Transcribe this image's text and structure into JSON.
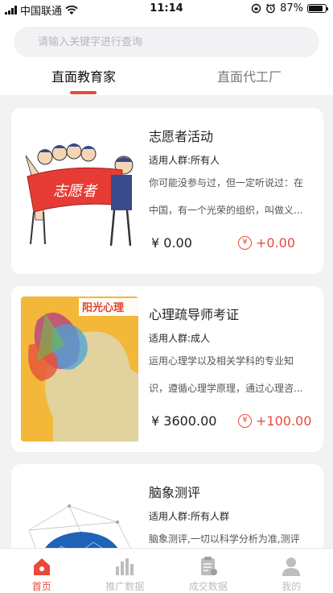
{
  "status": {
    "carrier": "中国联通",
    "time": "11:14",
    "battery": "87%",
    "battery_level": 0.87
  },
  "search": {
    "placeholder": "请输入关键字进行查询"
  },
  "tabs": [
    {
      "label": "直面教育家"
    },
    {
      "label": "直面代工厂"
    }
  ],
  "cards": [
    {
      "title": "志愿者活动",
      "audience": "适用人群:所有人",
      "desc1": "你可能没参与过，但一定听说过：在",
      "desc2": "中国，有一个光荣的组织，叫做义...",
      "price": "¥ 0.00",
      "reward": "+0.00",
      "image": "volunteer-illustration",
      "banner_text": "志愿者"
    },
    {
      "title": "心理疏导师考证",
      "audience": "适用人群:成人",
      "desc1": "运用心理学以及相关学科的专业知",
      "desc2": "识，遵循心理学原理，通过心理咨...",
      "price": "¥ 3600.00",
      "reward": "+100.00",
      "image": "psychology-poster",
      "banner_text": "阳光心理"
    },
    {
      "title": "脑象测评",
      "audience": "适用人群:所有人群",
      "desc1": "脑象测评,一切以科学分析为准,测评",
      "desc2": "",
      "price": "",
      "reward": "",
      "image": "brain-network"
    }
  ],
  "tabbar": [
    {
      "label": "首页",
      "icon": "home-icon"
    },
    {
      "label": "推广数据",
      "icon": "bar-chart-icon"
    },
    {
      "label": "成交数据",
      "icon": "clipboard-icon"
    },
    {
      "label": "我的",
      "icon": "user-icon"
    }
  ],
  "colors": {
    "accent": "#e84a3b",
    "inactive": "#bdbdbd"
  }
}
